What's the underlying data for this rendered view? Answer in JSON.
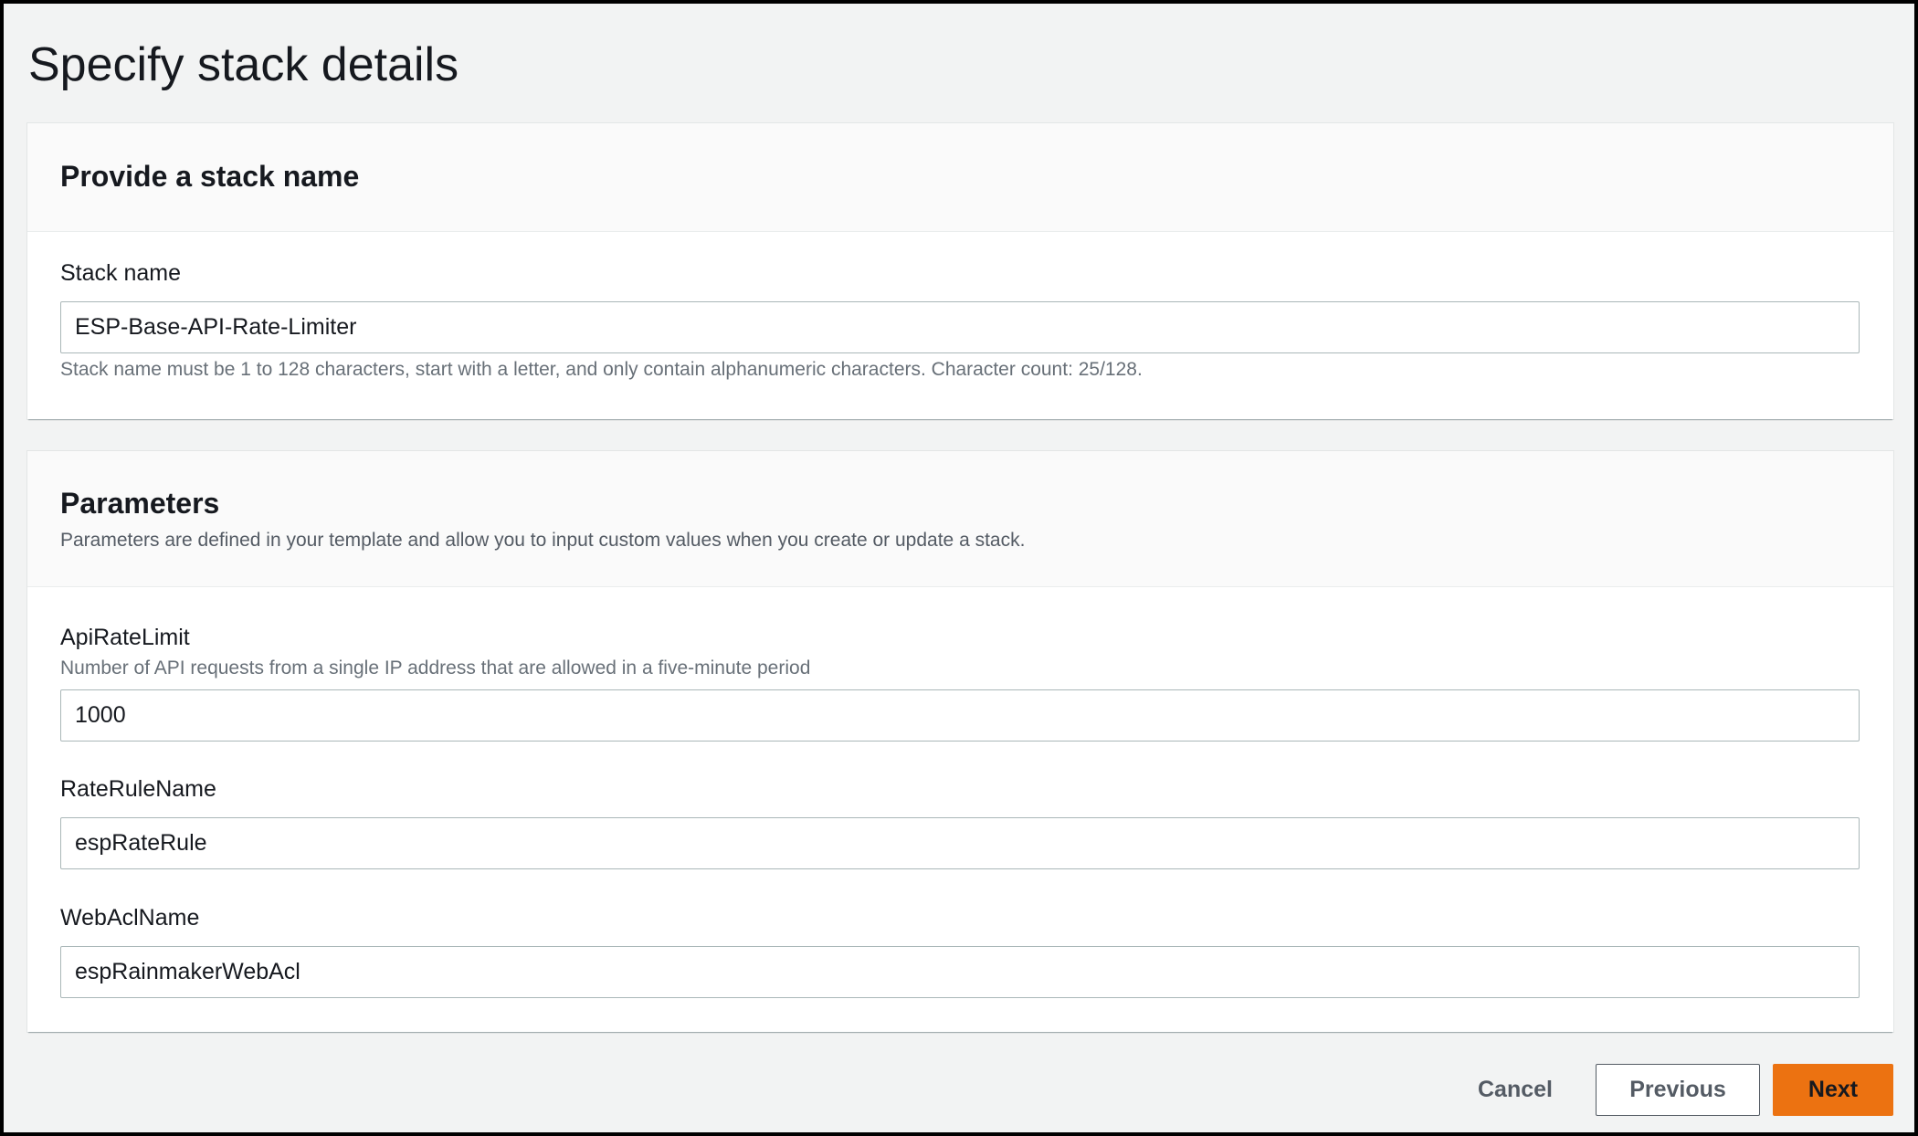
{
  "page": {
    "title": "Specify stack details"
  },
  "stack_name_section": {
    "title": "Provide a stack name",
    "field_label": "Stack name",
    "field_value": "ESP-Base-API-Rate-Limiter",
    "constraint_text": "Stack name must be 1 to 128 characters, start with a letter, and only contain alphanumeric characters. Character count: 25/128."
  },
  "parameters_section": {
    "title": "Parameters",
    "description": "Parameters are defined in your template and allow you to input custom values when you create or update a stack.",
    "fields": [
      {
        "label": "ApiRateLimit",
        "description": "Number of API requests from a single IP address that are allowed in a five-minute period",
        "value": "1000"
      },
      {
        "label": "RateRuleName",
        "value": "espRateRule"
      },
      {
        "label": "WebAclName",
        "value": "espRainmakerWebAcl"
      }
    ]
  },
  "footer": {
    "cancel_label": "Cancel",
    "previous_label": "Previous",
    "next_label": "Next"
  },
  "colors": {
    "page_background": "#f2f3f3",
    "panel_header_background": "#fafafa",
    "primary_button": "#ec7211",
    "text_primary": "#16191f",
    "text_secondary": "#687078"
  }
}
